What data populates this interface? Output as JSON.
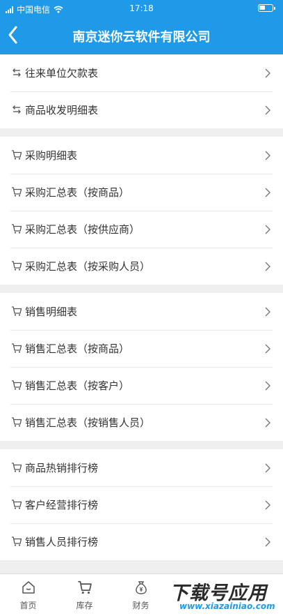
{
  "status_bar": {
    "carrier": "中国电信",
    "time": "17:18"
  },
  "header": {
    "title": "南京迷你云软件有限公司"
  },
  "sections": [
    {
      "items": [
        {
          "label": "往来单位欠款表",
          "icon": "transfer-icon"
        },
        {
          "label": "商品收发明细表",
          "icon": "transfer-icon"
        }
      ]
    },
    {
      "items": [
        {
          "label": "采购明细表",
          "icon": "cart-icon"
        },
        {
          "label": "采购汇总表（按商品）",
          "icon": "cart-icon"
        },
        {
          "label": "采购汇总表（按供应商）",
          "icon": "cart-icon"
        },
        {
          "label": "采购汇总表（按采购人员）",
          "icon": "cart-icon"
        }
      ]
    },
    {
      "items": [
        {
          "label": "销售明细表",
          "icon": "cart-icon"
        },
        {
          "label": "销售汇总表（按商品）",
          "icon": "cart-icon"
        },
        {
          "label": "销售汇总表（按客户）",
          "icon": "cart-icon"
        },
        {
          "label": "销售汇总表（按销售人员）",
          "icon": "cart-icon"
        }
      ]
    },
    {
      "items": [
        {
          "label": "商品热销排行榜",
          "icon": "cart-icon"
        },
        {
          "label": "客户经营排行榜",
          "icon": "cart-icon"
        },
        {
          "label": "销售人员排行榜",
          "icon": "cart-icon"
        }
      ]
    }
  ],
  "tabbar": [
    {
      "label": "首页",
      "icon": "home-icon"
    },
    {
      "label": "库存",
      "icon": "cart-icon"
    },
    {
      "label": "财务",
      "icon": "money-bag-icon"
    }
  ],
  "watermark": {
    "text": "下载号应用",
    "url": "www.xiazainiao.com"
  },
  "colors": {
    "header": "#1e9ae9",
    "background": "#efefef"
  }
}
